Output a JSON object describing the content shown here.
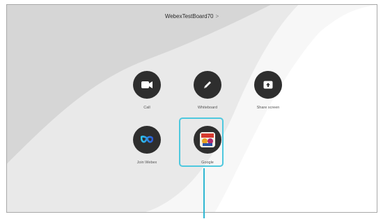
{
  "header": {
    "device_name": "WebexTestBoard70",
    "chevron": ">"
  },
  "actions": [
    {
      "label": "Call",
      "icon": "video-camera-icon"
    },
    {
      "label": "Whiteboard",
      "icon": "pen-icon"
    },
    {
      "label": "Share screen",
      "icon": "share-screen-icon"
    },
    {
      "label": "Join Webex",
      "icon": "webex-logo-icon"
    },
    {
      "label": "Google",
      "icon": "app-thumbnail-icon"
    }
  ],
  "colors": {
    "button_bg": "#2e2e2e",
    "highlight": "#4ec8de"
  }
}
